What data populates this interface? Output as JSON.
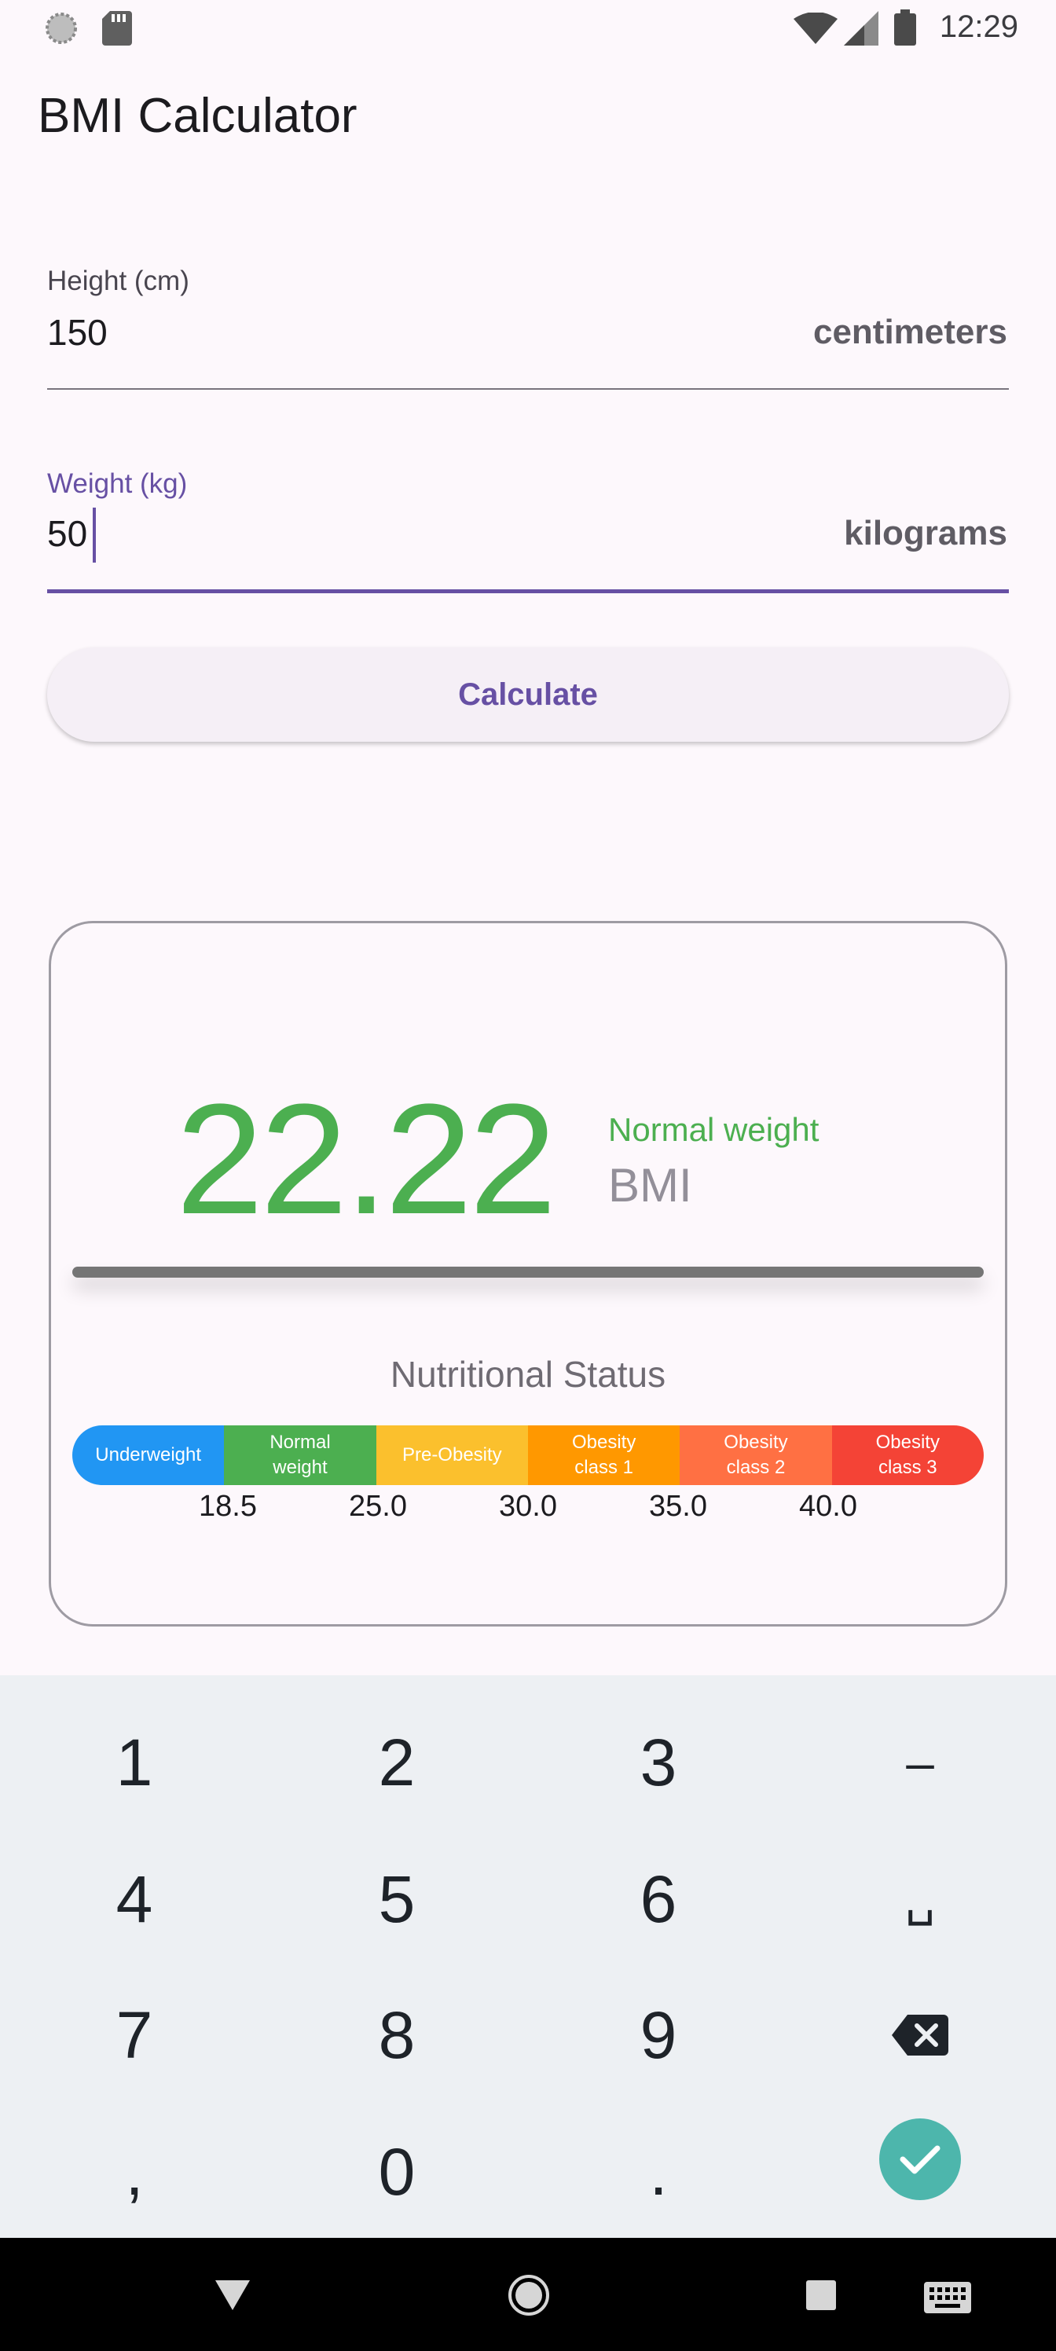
{
  "status_bar": {
    "time": "12:29",
    "left_icons": [
      "loading-circle-icon",
      "sd-card-icon"
    ],
    "right_icons": [
      "wifi-icon",
      "cell-signal-icon",
      "battery-icon"
    ]
  },
  "app_bar": {
    "title": "BMI Calculator"
  },
  "form": {
    "height": {
      "label": "Height (cm)",
      "value": "150",
      "suffix": "centimeters"
    },
    "weight": {
      "label": "Weight (kg)",
      "value": "50",
      "suffix": "kilograms",
      "focused": true
    },
    "calculate_label": "Calculate"
  },
  "result": {
    "bmi_value": "22.22",
    "category": "Normal weight",
    "unit": "BMI",
    "nutrition_title": "Nutritional Status",
    "scale": [
      {
        "label": "Underweight",
        "color": "#2196f3"
      },
      {
        "label": "Normal weight",
        "color": "#4caf50"
      },
      {
        "label": "Pre-Obesity",
        "color": "#fbc02d"
      },
      {
        "label": "Obesity class 1",
        "color": "#ff9800"
      },
      {
        "label": "Obesity class 2",
        "color": "#ff7043"
      },
      {
        "label": "Obesity class 3",
        "color": "#f44336"
      }
    ],
    "thresholds": [
      "18.5",
      "25.0",
      "30.0",
      "35.0",
      "40.0"
    ],
    "colors": {
      "accent": "#4caf50",
      "muted": "#938f99"
    }
  },
  "keyboard": {
    "keys": [
      {
        "label": "1",
        "name": "key-1"
      },
      {
        "label": "2",
        "name": "key-2"
      },
      {
        "label": "3",
        "name": "key-3"
      },
      {
        "label": "–",
        "name": "key-minus"
      },
      {
        "label": "4",
        "name": "key-4"
      },
      {
        "label": "5",
        "name": "key-5"
      },
      {
        "label": "6",
        "name": "key-6"
      },
      {
        "label": "␣",
        "name": "key-space"
      },
      {
        "label": "7",
        "name": "key-7"
      },
      {
        "label": "8",
        "name": "key-8"
      },
      {
        "label": "9",
        "name": "key-9"
      },
      {
        "label": "",
        "name": "key-backspace",
        "icon": "backspace-icon"
      },
      {
        "label": ",",
        "name": "key-comma"
      },
      {
        "label": "0",
        "name": "key-0"
      },
      {
        "label": ".",
        "name": "key-period"
      }
    ],
    "confirm_icon": "check-icon",
    "accent": "#4db6ac"
  },
  "nav_bar": {
    "icons": [
      "back-icon",
      "home-icon",
      "recents-icon",
      "keyboard-switch-icon"
    ]
  }
}
